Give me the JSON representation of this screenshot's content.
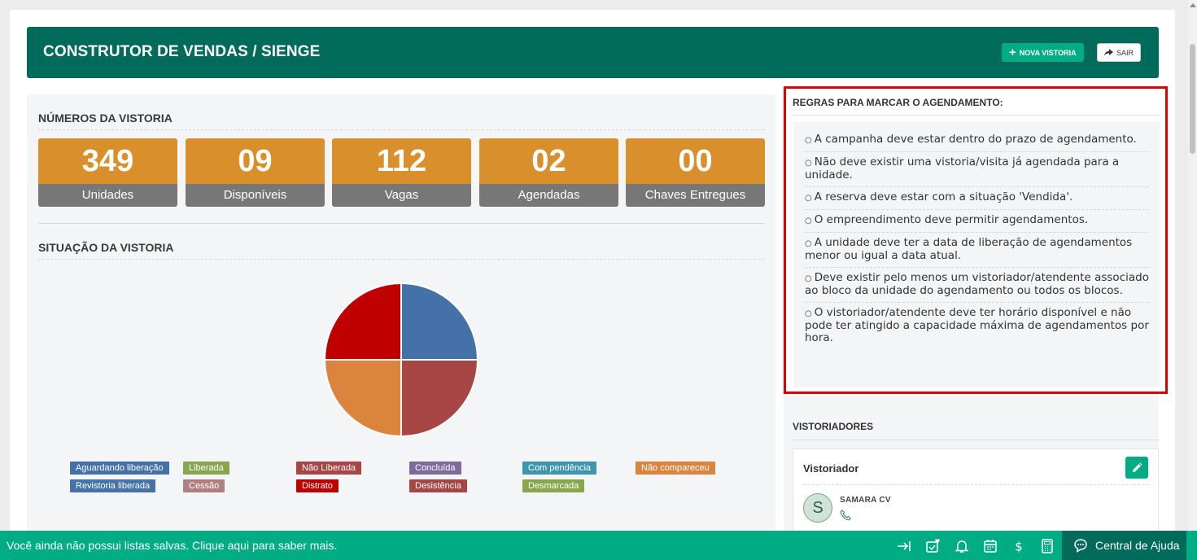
{
  "header": {
    "title": "CONSTRUTOR DE VENDAS / SIENGE",
    "new_button": "NOVA VISTORIA",
    "exit_button": "SAIR"
  },
  "numbers": {
    "title": "NÚMEROS DA VISTORIA",
    "stats": [
      {
        "value": "349",
        "label": "Unidades"
      },
      {
        "value": "09",
        "label": "Disponíveis"
      },
      {
        "value": "112",
        "label": "Vagas"
      },
      {
        "value": "02",
        "label": "Agendadas"
      },
      {
        "value": "00",
        "label": "Chaves Entregues"
      }
    ]
  },
  "situation": {
    "title": "SITUAÇÃO DA VISTORIA",
    "pie_slices": [
      {
        "color": "#4472a8",
        "fraction": 0.25
      },
      {
        "color": "#a84545",
        "fraction": 0.25
      },
      {
        "color": "#db843d",
        "fraction": 0.25
      },
      {
        "color": "#c00000",
        "fraction": 0.25
      }
    ],
    "legend": [
      {
        "label": "Aguardando liberação",
        "color": "#4472a8"
      },
      {
        "label": "Liberada",
        "color": "#89a54e"
      },
      {
        "label": "Não Liberada",
        "color": "#a84545"
      },
      {
        "label": "Concluída",
        "color": "#80699b"
      },
      {
        "label": "Com pendência",
        "color": "#3d96ae"
      },
      {
        "label": "Não compareceu",
        "color": "#db843d"
      },
      {
        "label": "Revistoria liberada",
        "color": "#4572a7"
      },
      {
        "label": "Cessão",
        "color": "#b07f7f"
      },
      {
        "label": "Distrato",
        "color": "#c00000"
      },
      {
        "label": "Desistência",
        "color": "#a84545"
      },
      {
        "label": "Desmarcada",
        "color": "#89a54e"
      }
    ]
  },
  "rules": {
    "title": "REGRAS PARA MARCAR O AGENDAMENTO:",
    "items": [
      "A campanha deve estar dentro do prazo de agendamento.",
      "Não deve existir uma vistoria/visita já agendada para a unidade.",
      "A reserva deve estar com a situação 'Vendida'.",
      "O empreendimento deve permitir agendamentos.",
      "A unidade deve ter a data de liberação de agendamentos menor ou igual a data atual.",
      "Deve existir pelo menos um vistoriador/atendente associado ao bloco da unidade do agendamento ou todos os blocos.",
      "O vistoriador/atendente deve ter horário disponível e não pode ter atingido a capacidade máxima de agendamentos por hora."
    ]
  },
  "inspectors": {
    "title": "VISTORIADORES",
    "card_label": "Vistoriador",
    "avatar_letter": "S",
    "name": "SAMARA CV"
  },
  "bottombar": {
    "message": "Você ainda não possui listas salvas. Clique aqui para saber mais.",
    "help_label": "Central de Ajuda"
  }
}
